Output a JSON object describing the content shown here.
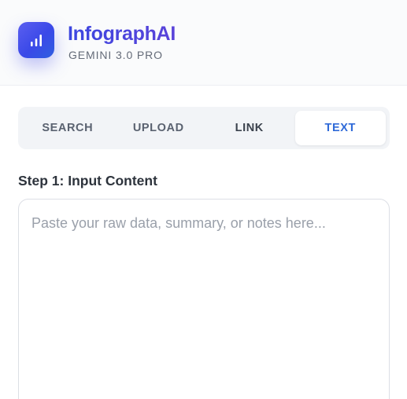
{
  "header": {
    "app_name": "InfographAI",
    "model_label": "GEMINI 3.0 PRO",
    "logo_icon": "bar-chart-icon",
    "accent_color": "#4548df"
  },
  "tabs": {
    "active": "TEXT",
    "items": [
      {
        "label": "SEARCH"
      },
      {
        "label": "UPLOAD"
      },
      {
        "label": "LINK"
      },
      {
        "label": "TEXT"
      }
    ]
  },
  "step": {
    "label": "Step 1: Input Content"
  },
  "content_input": {
    "value": "",
    "placeholder": "Paste your raw data, summary, or notes here..."
  }
}
